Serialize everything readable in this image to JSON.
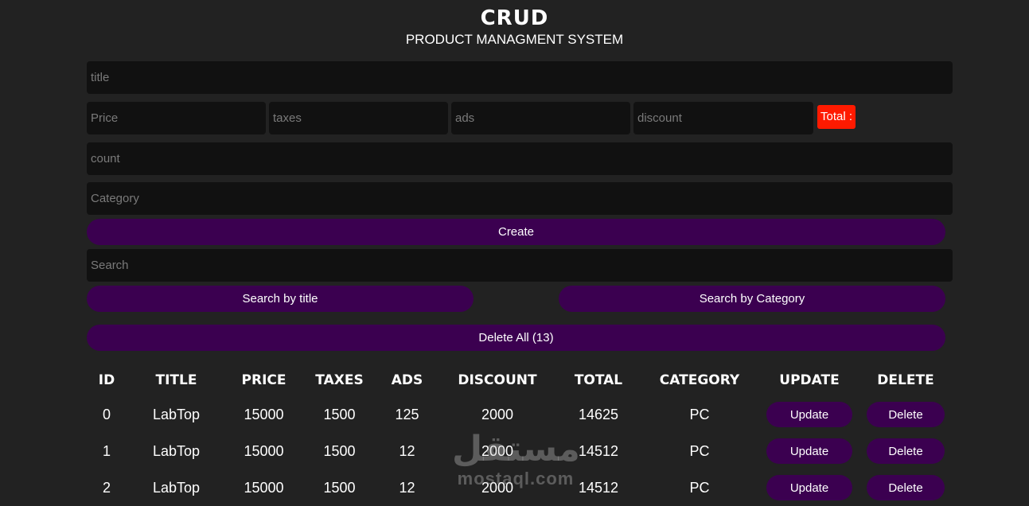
{
  "header": {
    "title": "CRUD",
    "subtitle": "PRODUCT MANAGMENT SYSTEM"
  },
  "form": {
    "title_placeholder": "title",
    "price_placeholder": "Price",
    "taxes_placeholder": "taxes",
    "ads_placeholder": "ads",
    "discount_placeholder": "discount",
    "total_label": "Total :",
    "count_placeholder": "count",
    "category_placeholder": "Category",
    "create_label": "Create"
  },
  "search": {
    "placeholder": "Search",
    "by_title_label": "Search by title",
    "by_category_label": "Search by Category"
  },
  "delete_all_label": "Delete All (13)",
  "table": {
    "headers": [
      "ID",
      "TITLE",
      "PRICE",
      "TAXES",
      "ADS",
      "DISCOUNT",
      "TOTAL",
      "CATEGORY",
      "UPDATE",
      "DELETE"
    ],
    "update_label": "Update",
    "delete_label": "Delete",
    "rows": [
      {
        "id": "0",
        "title": "LabTop",
        "price": "15000",
        "taxes": "1500",
        "ads": "125",
        "discount": "2000",
        "total": "14625",
        "category": "PC"
      },
      {
        "id": "1",
        "title": "LabTop",
        "price": "15000",
        "taxes": "1500",
        "ads": "12",
        "discount": "2000",
        "total": "14512",
        "category": "PC"
      },
      {
        "id": "2",
        "title": "LabTop",
        "price": "15000",
        "taxes": "1500",
        "ads": "12",
        "discount": "2000",
        "total": "14512",
        "category": "PC"
      }
    ]
  },
  "watermark": {
    "arabic": "مستقل",
    "latin": "mostaql.com"
  },
  "colors": {
    "background": "#222222",
    "input_bg": "#111111",
    "button": "#3b0050",
    "total_bg": "#ff1a00"
  }
}
